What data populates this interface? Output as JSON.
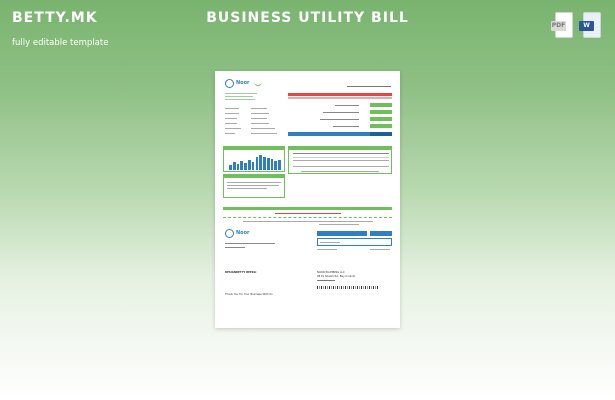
{
  "brand": {
    "name": "BETTY.MK",
    "tagline": "fully editable template"
  },
  "title": "BUSINESS UTILITY BILL",
  "icons": {
    "pdf": {
      "label": "PDF",
      "icon": "pdf-file-icon"
    },
    "word": {
      "label": "W",
      "icon": "word-file-icon"
    }
  },
  "colors": {
    "green": "#6fbf5a",
    "blue": "#2f7fc1",
    "red": "#e04646"
  },
  "document": {
    "logo": "Noor",
    "account_summary": "Account Summary",
    "chart_values": [
      0.3,
      0.45,
      0.35,
      0.5,
      0.4,
      0.55,
      0.45,
      0.7,
      0.85,
      0.75,
      0.65,
      0.6,
      0.5,
      0.55
    ],
    "company_name": "NOOR PLUMBING LLC",
    "company_address": "98 EL Sheikh Rd, Bay Coulom",
    "customer_name": "DESIGNBETTY BEERLI",
    "footer_note": "Thank You For Your Business With Us"
  }
}
